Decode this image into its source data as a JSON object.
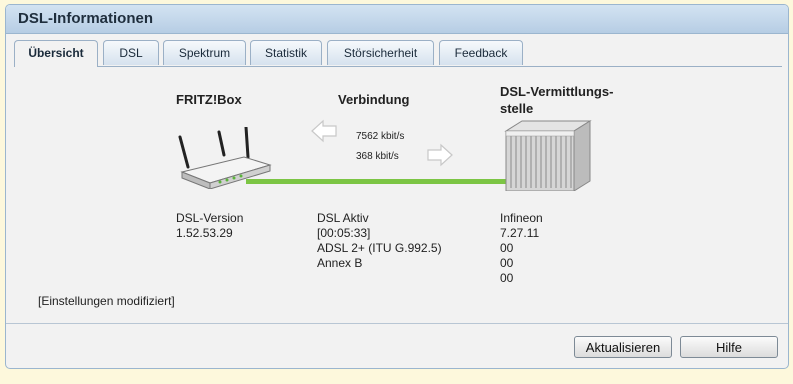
{
  "panel": {
    "title": "DSL-Informationen"
  },
  "tabs": [
    {
      "label": "Übersicht"
    },
    {
      "label": "DSL"
    },
    {
      "label": "Spektrum"
    },
    {
      "label": "Statistik"
    },
    {
      "label": "Störsicherheit"
    },
    {
      "label": "Feedback"
    }
  ],
  "overview": {
    "fritzbox": {
      "heading": "FRITZ!Box",
      "version_label": "DSL-Version",
      "version_value": "1.52.53.29",
      "icon": "router-icon"
    },
    "connection": {
      "heading": "Verbindung",
      "downstream": "7562 kbit/s",
      "upstream": "368 kbit/s",
      "status": "DSL Aktiv",
      "duration": "[00:05:33]",
      "mode": "ADSL 2+ (ITU G.992.5)",
      "annex": "Annex B",
      "line_color": "#7cc544"
    },
    "exchange": {
      "heading_line1": "DSL-Vermittlungs-",
      "heading_line2": "stelle",
      "vendor": "Infineon",
      "version": "7.27.11",
      "val1": "00",
      "val2": "00",
      "val3": "00",
      "icon": "dslam-icon"
    },
    "settings_note": "[Einstellungen modifiziert]"
  },
  "buttons": {
    "refresh": "Aktualisieren",
    "help": "Hilfe"
  }
}
